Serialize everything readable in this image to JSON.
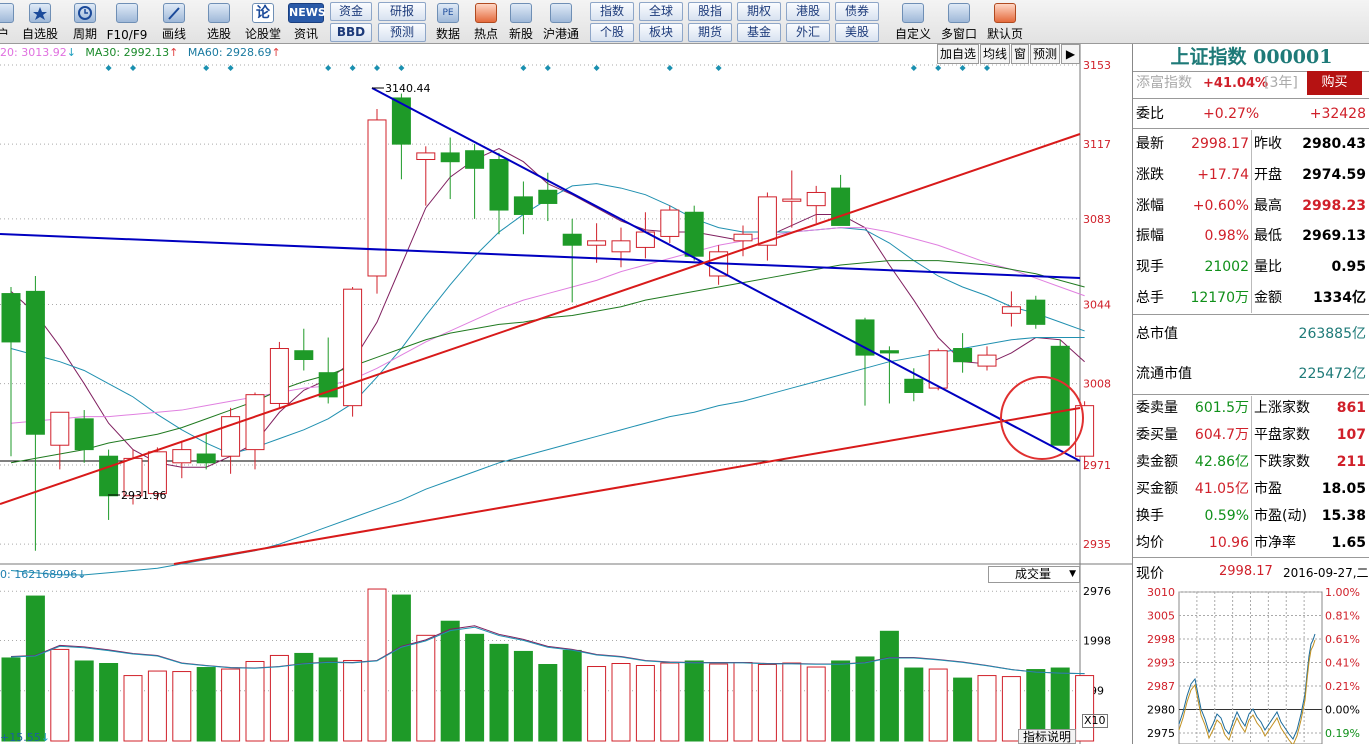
{
  "toolbar": {
    "icon_buttons": [
      {
        "label": "户",
        "icon": "user-icon"
      },
      {
        "label": "自选股",
        "icon": "star-icon"
      },
      {
        "label": "周期",
        "icon": "clock-icon"
      },
      {
        "label": "F10/F9",
        "icon": "f10-icon"
      },
      {
        "label": "画线",
        "icon": "pen-icon"
      },
      {
        "label": "选股",
        "icon": "screen-icon"
      },
      {
        "label": "论股堂",
        "icon": "lun-icon"
      },
      {
        "label": "资讯",
        "icon": "news-icon"
      },
      {
        "label": "数据",
        "icon": "pe-icon"
      },
      {
        "label": "热点",
        "icon": "hot-icon"
      },
      {
        "label": "新股",
        "icon": "ipo-icon"
      },
      {
        "label": "沪港通",
        "icon": "hk-icon"
      },
      {
        "label": "自定义",
        "icon": "custom-icon"
      },
      {
        "label": "多窗口",
        "icon": "multiwindow-icon"
      },
      {
        "label": "默认页",
        "icon": "home-icon"
      }
    ],
    "menu_buttons": {
      "zijin": "资金",
      "yanbao": "研报",
      "bbd": "BBD",
      "yuce": "预测",
      "zhishu": "指数",
      "quanqiu": "全球",
      "guzhi": "股指",
      "qiquan": "期权",
      "ganggu": "港股",
      "zhaiquan": "债券",
      "gegu": "个股",
      "bankuai": "板块",
      "qihuo": "期货",
      "jijin": "基金",
      "waihui": "外汇",
      "meigu": "美股"
    },
    "news_badge": "NEWS"
  },
  "chart_header": {
    "ma20": "20: 3013.92",
    "ma20_arrow": "↓",
    "ma30": "MA30: 2992.13",
    "ma30_arrow": "↑",
    "ma60": "MA60: 2928.69",
    "ma60_arrow": "↑"
  },
  "chart_tabs": {
    "addfav": "加自选",
    "junxian": "均线",
    "window": "窗",
    "yuce": "预测",
    "next": "▶"
  },
  "colors": {
    "up": "#d0202a",
    "down": "#1e9a28",
    "trend_blue": "#0000c0",
    "trend_red": "#d81a1a",
    "ma_purple": "#802060",
    "ma_pink": "#e080e0",
    "ma_green": "#207a20",
    "ma_teal": "#208090"
  },
  "chart_data": {
    "type": "candlestick",
    "price_axis": {
      "ticks": [
        3153,
        3117,
        3083,
        3044,
        3008,
        2971,
        2935
      ],
      "range": [
        2890,
        3160
      ]
    },
    "annotations": {
      "high": "3140.44",
      "low": "2931.96"
    },
    "candles": [
      {
        "o": 3049,
        "h": 3052,
        "l": 2975,
        "c": 3027
      },
      {
        "o": 3050,
        "h": 3057,
        "l": 2932,
        "c": 2985
      },
      {
        "o": 2980,
        "h": 2992,
        "l": 2969,
        "c": 2995
      },
      {
        "o": 2992,
        "h": 2996,
        "l": 2972,
        "c": 2978
      },
      {
        "o": 2975,
        "h": 2978,
        "l": 2946,
        "c": 2957
      },
      {
        "o": 2957,
        "h": 2978,
        "l": 2953,
        "c": 2974
      },
      {
        "o": 2958,
        "h": 2979,
        "l": 2955,
        "c": 2977
      },
      {
        "o": 2972,
        "h": 2982,
        "l": 2965,
        "c": 2978
      },
      {
        "o": 2976,
        "h": 2985,
        "l": 2969,
        "c": 2972
      },
      {
        "o": 2975,
        "h": 2997,
        "l": 2967,
        "c": 2993
      },
      {
        "o": 2978,
        "h": 3004,
        "l": 2969,
        "c": 3003
      },
      {
        "o": 2999,
        "h": 3027,
        "l": 2997,
        "c": 3024
      },
      {
        "o": 3023,
        "h": 3033,
        "l": 3014,
        "c": 3019
      },
      {
        "o": 3013,
        "h": 3029,
        "l": 2999,
        "c": 3002
      },
      {
        "o": 2998,
        "h": 3052,
        "l": 2993,
        "c": 3051
      },
      {
        "o": 3057,
        "h": 3133,
        "l": 3049,
        "c": 3128
      },
      {
        "o": 3138,
        "h": 3140,
        "l": 3101,
        "c": 3117
      },
      {
        "o": 3110,
        "h": 3116,
        "l": 3089,
        "c": 3113
      },
      {
        "o": 3113,
        "h": 3120,
        "l": 3092,
        "c": 3109
      },
      {
        "o": 3114,
        "h": 3117,
        "l": 3083,
        "c": 3106
      },
      {
        "o": 3110,
        "h": 3113,
        "l": 3076,
        "c": 3087
      },
      {
        "o": 3093,
        "h": 3100,
        "l": 3076,
        "c": 3085
      },
      {
        "o": 3096,
        "h": 3104,
        "l": 3082,
        "c": 3090
      },
      {
        "o": 3076,
        "h": 3083,
        "l": 3045,
        "c": 3071
      },
      {
        "o": 3071,
        "h": 3081,
        "l": 3063,
        "c": 3073
      },
      {
        "o": 3068,
        "h": 3079,
        "l": 3061,
        "c": 3073
      },
      {
        "o": 3070,
        "h": 3086,
        "l": 3065,
        "c": 3077
      },
      {
        "o": 3075,
        "h": 3089,
        "l": 3072,
        "c": 3087
      },
      {
        "o": 3086,
        "h": 3089,
        "l": 3064,
        "c": 3066
      },
      {
        "o": 3057,
        "h": 3071,
        "l": 3053,
        "c": 3068
      },
      {
        "o": 3073,
        "h": 3080,
        "l": 3066,
        "c": 3076
      },
      {
        "o": 3071,
        "h": 3095,
        "l": 3064,
        "c": 3093
      },
      {
        "o": 3091,
        "h": 3105,
        "l": 3079,
        "c": 3092
      },
      {
        "o": 3089,
        "h": 3098,
        "l": 3081,
        "c": 3095
      },
      {
        "o": 3097,
        "h": 3103,
        "l": 3080,
        "c": 3080
      },
      {
        "o": 3037,
        "h": 3038,
        "l": 2998,
        "c": 3021
      },
      {
        "o": 3023,
        "h": 3025,
        "l": 2999,
        "c": 3022
      },
      {
        "o": 3010,
        "h": 3015,
        "l": 3000,
        "c": 3004
      },
      {
        "o": 3006,
        "h": 3024,
        "l": 3005,
        "c": 3023
      },
      {
        "o": 3024,
        "h": 3031,
        "l": 3013,
        "c": 3018
      },
      {
        "o": 3016,
        "h": 3025,
        "l": 3014,
        "c": 3021
      },
      {
        "o": 3040,
        "h": 3050,
        "l": 3034,
        "c": 3043
      },
      {
        "o": 3046,
        "h": 3048,
        "l": 3033,
        "c": 3035
      },
      {
        "o": 3025,
        "h": 3028,
        "l": 2980,
        "c": 2980
      },
      {
        "o": 2975,
        "h": 3000,
        "l": 2969,
        "c": 2998
      }
    ],
    "ma_lines": [
      {
        "name": "MA5",
        "values": [
          3050,
          3040,
          3025,
          3008,
          2990,
          2978,
          2972,
          2970,
          2970,
          2975,
          2981,
          2995,
          3005,
          3010,
          3018,
          3036,
          3062,
          3088,
          3102,
          3110,
          3115,
          3109,
          3099,
          3094,
          3088,
          3082,
          3078,
          3077,
          3077,
          3075,
          3073,
          3075,
          3080,
          3085,
          3085,
          3079,
          3062,
          3046,
          3029,
          3018,
          3017,
          3022,
          3029,
          3028,
          3018
        ]
      },
      {
        "name": "MA10",
        "values": [
          3024,
          3021,
          3018,
          3014,
          3008,
          3002,
          2994,
          2987,
          2981,
          2976,
          2979,
          2983,
          2987,
          2992,
          2999,
          3011,
          3024,
          3039,
          3053,
          3066,
          3077,
          3085,
          3092,
          3098,
          3099,
          3097,
          3094,
          3089,
          3083,
          3079,
          3077,
          3077,
          3077,
          3078,
          3079,
          3078,
          3072,
          3064,
          3057,
          3052,
          3048,
          3043,
          3040,
          3036,
          3032
        ]
      },
      {
        "name": "MA20",
        "values": [
          2990,
          2991,
          2992,
          2993,
          2993,
          2994,
          2995,
          2996,
          2998,
          3000,
          3002,
          3004,
          3006,
          3007,
          3010,
          3015,
          3021,
          3027,
          3032,
          3037,
          3042,
          3046,
          3049,
          3052,
          3055,
          3059,
          3062,
          3065,
          3068,
          3071,
          3073,
          3075,
          3077,
          3078,
          3079,
          3079,
          3077,
          3074,
          3071,
          3067,
          3063,
          3060,
          3056,
          3052,
          3048
        ]
      },
      {
        "name": "MA30",
        "values": [
          2972,
          2974,
          2976,
          2978,
          2981,
          2983,
          2985,
          2988,
          2992,
          2996,
          3000,
          3005,
          3009,
          3012,
          3016,
          3020,
          3024,
          3028,
          3031,
          3033,
          3035,
          3036,
          3038,
          3039,
          3041,
          3043,
          3046,
          3048,
          3050,
          3052,
          3054,
          3056,
          3058,
          3060,
          3062,
          3063,
          3064,
          3064,
          3064,
          3063,
          3062,
          3060,
          3058,
          3055,
          3052
        ]
      },
      {
        "name": "MA60",
        "values": [
          2923,
          2922,
          2921,
          2921,
          2922,
          2923,
          2924,
          2926,
          2928,
          2930,
          2932,
          2935,
          2939,
          2943,
          2947,
          2951,
          2955,
          2960,
          2964,
          2968,
          2972,
          2975,
          2978,
          2981,
          2984,
          2987,
          2990,
          2993,
          2995,
          2998,
          3000,
          3003,
          3006,
          3009,
          3012,
          3015,
          3018,
          3020,
          3022,
          3024,
          3026,
          3028,
          3029,
          3029,
          3029
        ]
      }
    ],
    "volume_axis": {
      "ticks": [
        2976,
        1998,
        999
      ],
      "unit": "X10"
    },
    "volume": [
      1650,
      2880,
      1820,
      1590,
      1540,
      1300,
      1390,
      1380,
      1460,
      1430,
      1580,
      1700,
      1740,
      1650,
      1600,
      3020,
      2900,
      2100,
      2380,
      2120,
      1920,
      1780,
      1520,
      1800,
      1480,
      1540,
      1500,
      1550,
      1590,
      1530,
      1560,
      1520,
      1550,
      1470,
      1590,
      1670,
      2180,
      1450,
      1430,
      1250,
      1300,
      1280,
      1420,
      1450,
      1300
    ],
    "volume_ma": [
      1680,
      1700,
      1900,
      1870,
      1810,
      1740,
      1700,
      1550,
      1500,
      1460,
      1450,
      1480,
      1540,
      1570,
      1560,
      1600,
      1880,
      2010,
      2220,
      2290,
      2120,
      2020,
      1880,
      1820,
      1720,
      1680,
      1600,
      1570,
      1560,
      1560,
      1560,
      1540,
      1540,
      1530,
      1530,
      1560,
      1660,
      1660,
      1620,
      1570,
      1500,
      1420,
      1370,
      1350,
      1340
    ]
  },
  "volume_header": {
    "label": "0: 162168996",
    "arrow": "↓",
    "selector": "成交量"
  },
  "bottom": {
    "left": "+15.55",
    "left_arrow": "↓",
    "indicator": "指标说明"
  },
  "panel": {
    "title": "上证指数 000001",
    "add_index": {
      "label": "添富指数",
      "value": "+41.04%",
      "period": "[3年]",
      "buy": "购买"
    },
    "weibi": {
      "label": "委比",
      "pct": "+0.27%",
      "val": "+32428"
    },
    "quote": [
      {
        "l1": "最新",
        "v1": "2998.17",
        "l2": "昨收",
        "v2": "2980.43"
      },
      {
        "l1": "涨跌",
        "v1": "+17.74",
        "l2": "开盘",
        "v2": "2974.59"
      },
      {
        "l1": "涨幅",
        "v1": "+0.60%",
        "l2": "最高",
        "v2": "2998.23"
      },
      {
        "l1": "振幅",
        "v1": "0.98%",
        "l2": "最低",
        "v2": "2969.13"
      },
      {
        "l1": "现手",
        "v1": "21002",
        "l2": "量比",
        "v2": "0.95"
      },
      {
        "l1": "总手",
        "v1": "12170万",
        "l2": "金额",
        "v2": "1334亿"
      }
    ],
    "zsz": {
      "label": "总市值",
      "value": "263885亿"
    },
    "ltsz": {
      "label": "流通市值",
      "value": "225472亿"
    },
    "stats": [
      {
        "l1": "委卖量",
        "v1": "601.5万",
        "l2": "上涨家数",
        "v2": "861"
      },
      {
        "l1": "委买量",
        "v1": "604.7万",
        "l2": "平盘家数",
        "v2": "107"
      },
      {
        "l1": "卖金额",
        "v1": "42.86亿",
        "l2": "下跌家数",
        "v2": "211"
      },
      {
        "l1": "买金额",
        "v1": "41.05亿",
        "l2": "市盈",
        "v2": "18.05"
      },
      {
        "l1": "换手",
        "v1": "0.59%",
        "l2": "市盈(动)",
        "v2": "15.38"
      },
      {
        "l1": "均价",
        "v1": "10.96",
        "l2": "市净率",
        "v2": "1.65"
      }
    ],
    "mini": {
      "xianjia": "现价",
      "price": "2998.17",
      "date": "2016-09-27,二",
      "left_ticks": [
        "3010",
        "3005",
        "2998",
        "2993",
        "2987",
        "2980",
        "2975"
      ],
      "right_ticks": [
        "1.00%",
        "0.81%",
        "0.61%",
        "0.41%",
        "0.21%",
        "0.00%",
        "0.19%"
      ]
    }
  }
}
